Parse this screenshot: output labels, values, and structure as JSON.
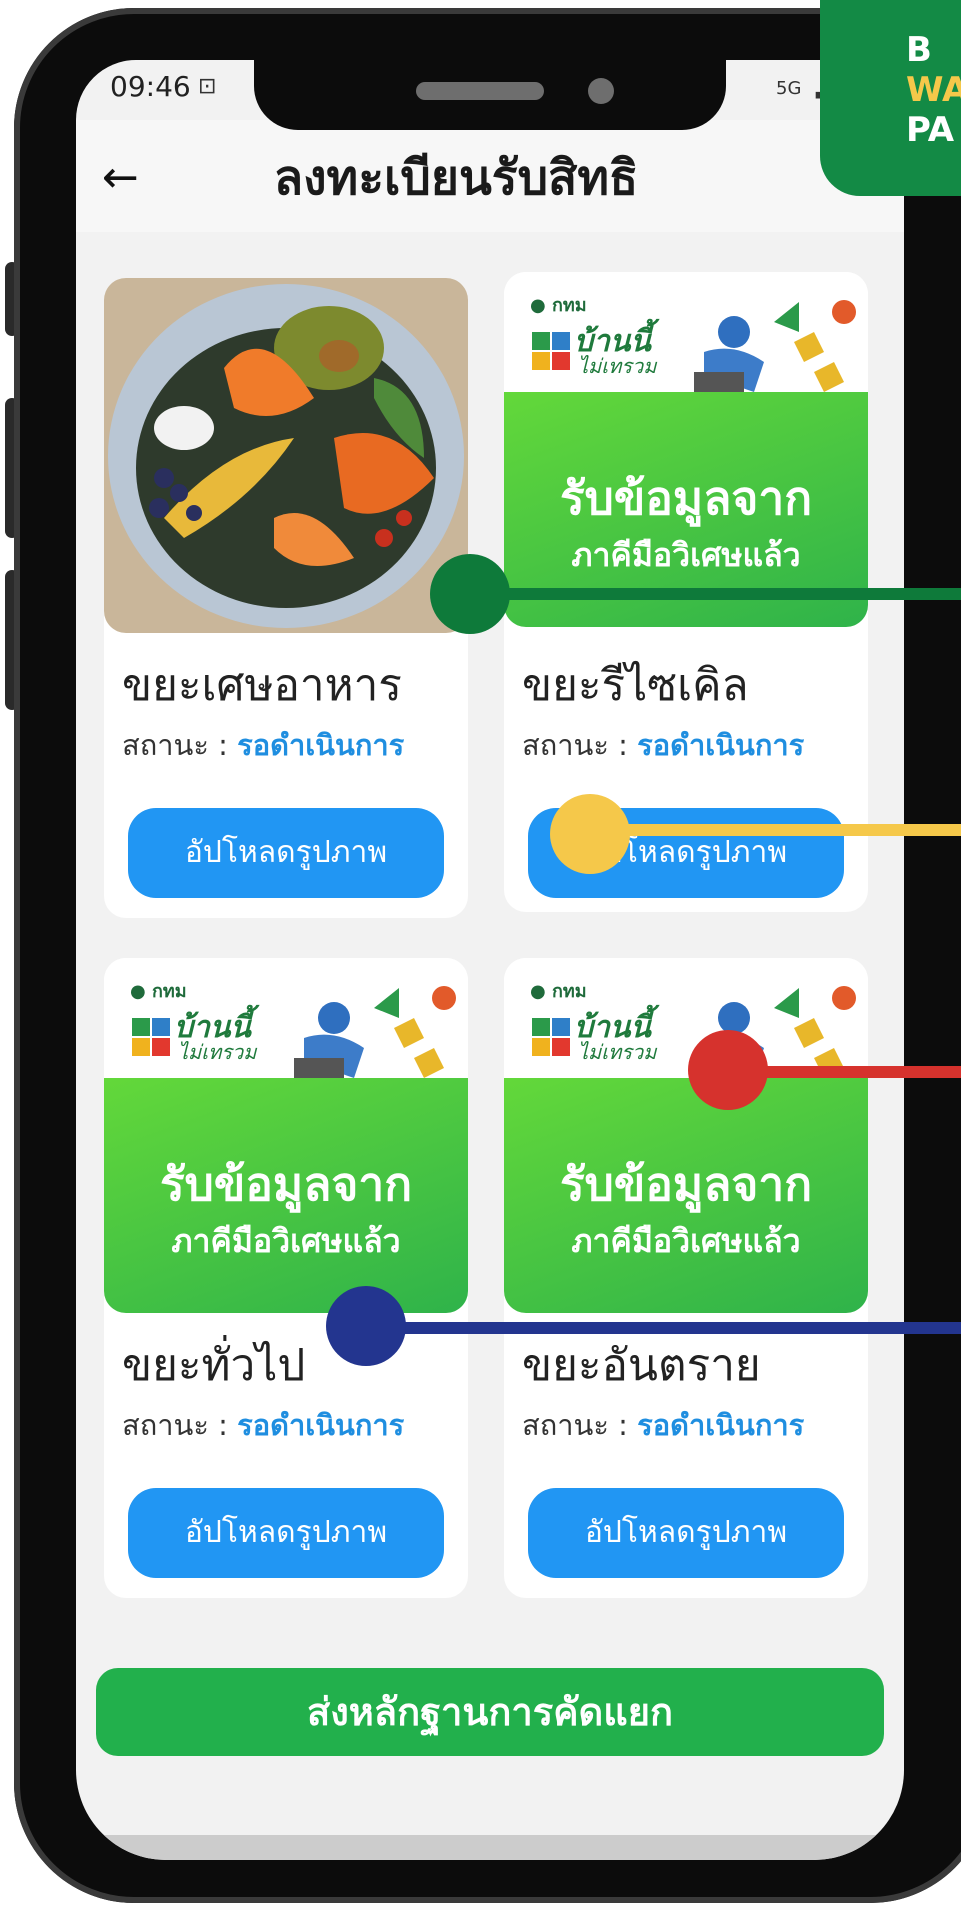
{
  "status_bar": {
    "time": "09:46",
    "network": "5G"
  },
  "header": {
    "back_icon": "arrow-left-icon",
    "title": "ลงทะเบียนรับสิทธิ"
  },
  "banner": {
    "line1": "รับข้อมูลจาก",
    "line2": "ภาคีมือวิเศษแล้ว",
    "logo": "กทม",
    "brand_main": "บ้านนี้",
    "brand_sub": "ไม่เทรวม"
  },
  "badge": {
    "text_lines": [
      "B",
      "WA",
      "PA"
    ]
  },
  "status_label": "สถานะ : ",
  "cards": [
    {
      "name": "ขยะเศษอาหาร",
      "status": "รอดำเนินการ",
      "upload": "อัปโหลดรูปภาพ",
      "image": "food-waste-photo"
    },
    {
      "name": "ขยะรีไซเคิล",
      "status": "รอดำเนินการ",
      "upload": "อัปโหลดรูปภาพ",
      "image": "banner"
    },
    {
      "name": "ขยะทั่วไป",
      "status": "รอดำเนินการ",
      "upload": "อัปโหลดรูปภาพ",
      "image": "banner"
    },
    {
      "name": "ขยะอันตราย",
      "status": "รอดำเนินการ",
      "upload": "อัปโหลดรูปภาพ",
      "image": "banner"
    }
  ],
  "submit": {
    "label": "ส่งหลักฐานการคัดแยก"
  },
  "markers": [
    {
      "color": "#0e7a3a"
    },
    {
      "color": "#f5c84a"
    },
    {
      "color": "#d6322d"
    },
    {
      "color": "#23358f"
    }
  ],
  "colors": {
    "primary_blue": "#2196f3",
    "submit_green": "#22b04c",
    "status_value": "#1f8ee0"
  }
}
